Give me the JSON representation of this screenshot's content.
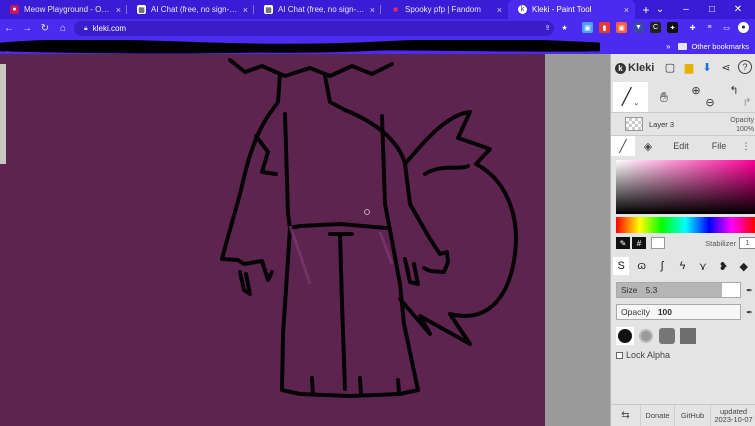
{
  "browser": {
    "tabs": [
      {
        "title": "Meow Playground - Online Pet",
        "favicon": "paw-icon",
        "active": false
      },
      {
        "title": "AI Chat (free, no sign-up, fast",
        "favicon": "chat-icon",
        "active": false
      },
      {
        "title": "AI Chat (free, no sign-up, fast",
        "favicon": "chat-icon",
        "active": false
      },
      {
        "title": "Spooky pfp | Fandom",
        "favicon": "fandom-icon",
        "active": false
      },
      {
        "title": "Kleki - Paint Tool",
        "favicon": "kleki-icon",
        "active": true
      }
    ],
    "new_tab": "+",
    "url": "kleki.com",
    "other_bookmarks": "Other bookmarks",
    "accent": "#4b2bef"
  },
  "kleki": {
    "logo": "Kleki",
    "layer_name": "Layer 3",
    "opacity_label": "Opacity",
    "opacity_value": "100%",
    "tabs": {
      "edit": "Edit",
      "file": "File"
    },
    "hex_symbol": "#",
    "stabilizer_label": "Stabilizer",
    "stabilizer_value": "1",
    "size_label": "Size",
    "size_value": "5.3",
    "size_fraction": 0.85,
    "brush_opacity_label": "Opacity",
    "brush_opacity_value": "100",
    "lock_alpha": "Lock Alpha",
    "footer": {
      "donate": "Donate",
      "github": "GitHub",
      "updated_label": "updated",
      "updated_date": "2023-10-07"
    },
    "canvas_color": "#5e2450"
  }
}
